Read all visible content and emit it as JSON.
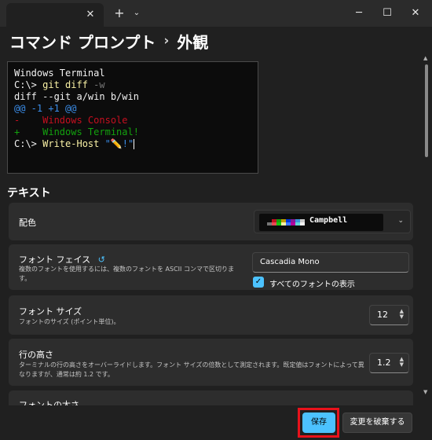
{
  "titlebar": {
    "tab_close_glyph": "✕",
    "new_tab_glyph": "+",
    "dropdown_glyph": "⌄",
    "minimize_glyph": "─",
    "maximize_glyph": "☐",
    "close_glyph": "✕"
  },
  "header": {
    "parent": "コマンド プロンプト",
    "separator": "›",
    "current": "外観"
  },
  "preview": {
    "lines": [
      "Windows Terminal",
      "C:\\> git diff -w",
      "diff --git a/win b/win",
      "@@ -1 +1 @@",
      "-    Windows Console",
      "+    Windows Terminal!",
      "C:\\> Write-Host \"✏️!\""
    ]
  },
  "section": {
    "title": "テキスト"
  },
  "color_scheme": {
    "label": "配色",
    "value": "Campbell",
    "swatches": [
      "#0c0c0c",
      "#c50f1f",
      "#13a10e",
      "#c19c00",
      "#0037da",
      "#881798",
      "#3a96dd",
      "#cccccc",
      "#767676",
      "#e74856",
      "#16c60c",
      "#f9f1a5",
      "#3b78ff",
      "#b4009e",
      "#61d6d6",
      "#f2f2f2"
    ]
  },
  "font_face": {
    "label": "フォント フェイス",
    "reset_icon": "↺",
    "description": "複数のフォントを使用するには、複数のフォントを ASCII コンマで区切ります。",
    "value": "Cascadia Mono",
    "show_all_label": "すべてのフォントの表示",
    "show_all_checked": true
  },
  "font_size": {
    "label": "フォント サイズ",
    "description": "フォントのサイズ (ポイント単位)。",
    "value": "12"
  },
  "line_height": {
    "label": "行の高さ",
    "description": "ターミナルの行の高さをオーバーライドします。フォント サイズの倍数として測定されます。既定値はフォントによって異なりますが、通常は約 1.2 です。",
    "value": "1.2"
  },
  "font_weight": {
    "label": "フォントの太さ"
  },
  "actions": {
    "save": "保存",
    "discard": "変更を破棄する"
  },
  "colors": {
    "accent": "#4cc2ff",
    "highlight": "#e8121b"
  }
}
